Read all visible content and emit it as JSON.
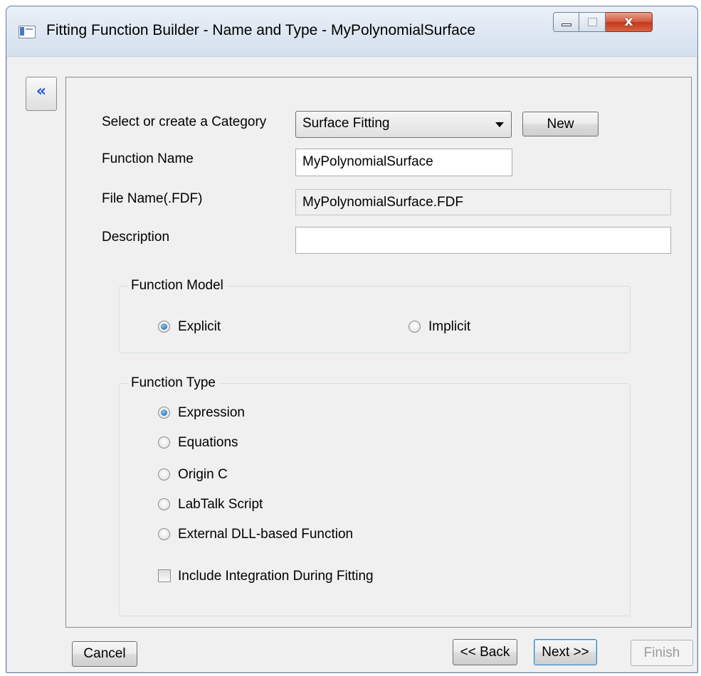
{
  "window": {
    "title": "Fitting Function Builder - Name and Type - MyPolynomialSurface",
    "close_glyph": "x",
    "collapse_glyph": "«"
  },
  "form": {
    "category_label": "Select or create a Category",
    "category_value": "Surface Fitting",
    "new_button": "New",
    "function_name_label": "Function Name",
    "function_name_value": "MyPolynomialSurface",
    "file_name_label": "File Name(.FDF)",
    "file_name_value": "MyPolynomialSurface.FDF",
    "description_label": "Description",
    "description_value": ""
  },
  "function_model": {
    "legend": "Function Model",
    "options": [
      {
        "label": "Explicit",
        "checked": true
      },
      {
        "label": "Implicit",
        "checked": false
      }
    ]
  },
  "function_type": {
    "legend": "Function Type",
    "options": [
      {
        "label": "Expression",
        "checked": true
      },
      {
        "label": "Equations",
        "checked": false
      },
      {
        "label": "Origin C",
        "checked": false
      },
      {
        "label": "LabTalk Script",
        "checked": false
      },
      {
        "label": "External DLL-based Function",
        "checked": false
      }
    ],
    "include_integration_label": "Include Integration During Fitting",
    "include_integration_checked": false
  },
  "footer": {
    "cancel": "Cancel",
    "back": "<< Back",
    "next": "Next >>",
    "finish": "Finish"
  }
}
